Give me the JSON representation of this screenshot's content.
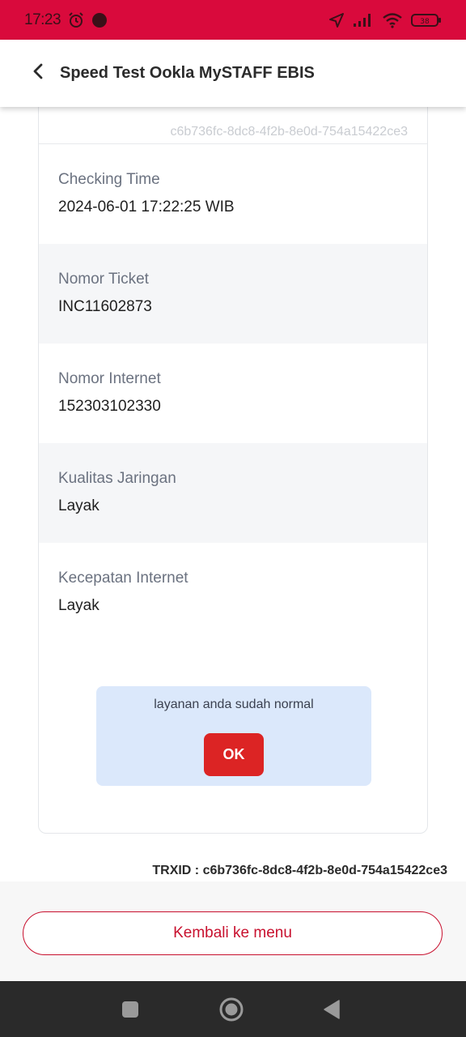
{
  "status_bar": {
    "time": "17:23",
    "icons": [
      "alarm-icon",
      "notification-dot-icon",
      "location-arrow-icon",
      "signal-icon",
      "wifi-icon",
      "battery-icon"
    ],
    "battery_level": "38"
  },
  "header": {
    "title": "Speed Test Ookla MySTAFF EBIS",
    "back_icon": "chevron-left-icon"
  },
  "card": {
    "id": "c6b736fc-8dc8-4f2b-8e0d-754a15422ce3",
    "rows": [
      {
        "label": "Checking Time",
        "value": "2024-06-01 17:22:25 WIB"
      },
      {
        "label": "Nomor Ticket",
        "value": "INC11602873"
      },
      {
        "label": "Nomor Internet",
        "value": "152303102330"
      },
      {
        "label": "Kualitas Jaringan",
        "value": "Layak"
      },
      {
        "label": "Kecepatan Internet",
        "value": "Layak"
      }
    ],
    "notice": {
      "text": "layanan anda sudah normal",
      "ok_label": "OK"
    }
  },
  "trxid": "TRXID : c6b736fc-8dc8-4f2b-8e0d-754a15422ce3",
  "bottom": {
    "back_menu_label": "Kembali ke menu"
  },
  "nav_bar": {
    "icons": [
      "recents-icon",
      "home-icon",
      "back-icon"
    ]
  },
  "colors": {
    "status_bar": "#d90a3c",
    "accent_red": "#c8102e",
    "ok_button": "#dc2424",
    "notice_bg": "#dbe8fb"
  }
}
